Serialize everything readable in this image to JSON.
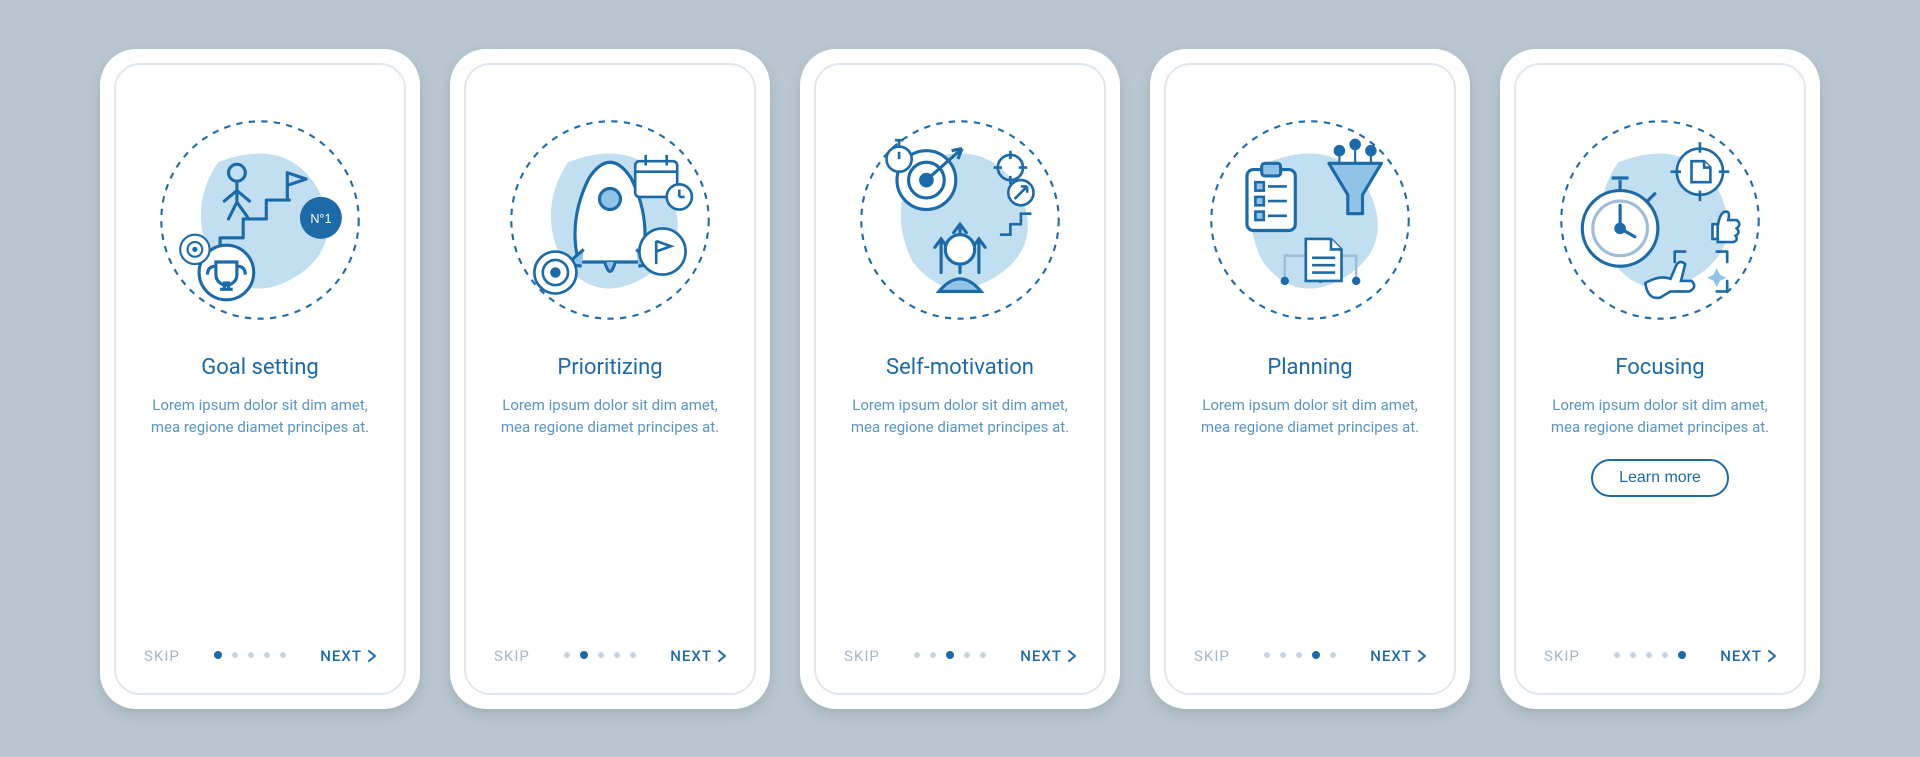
{
  "common": {
    "skip": "SKIP",
    "next": "NEXT",
    "learn_more": "Learn more",
    "description": "Lorem ipsum dolor sit dim amet, mea regione diamet principes at."
  },
  "screens": [
    {
      "title": "Goal setting",
      "icon": "goal",
      "active_dot": 0,
      "cta": false
    },
    {
      "title": "Prioritizing",
      "icon": "prioritize",
      "active_dot": 1,
      "cta": false
    },
    {
      "title": "Self-motivation",
      "icon": "motivation",
      "active_dot": 2,
      "cta": false
    },
    {
      "title": "Planning",
      "icon": "planning",
      "active_dot": 3,
      "cta": false
    },
    {
      "title": "Focusing",
      "icon": "focusing",
      "active_dot": 4,
      "cta": true
    }
  ],
  "colors": {
    "primary": "#1d6aa8",
    "secondary": "#5a95c1",
    "blob": "#8fc4e8",
    "light": "#c7d4df"
  }
}
